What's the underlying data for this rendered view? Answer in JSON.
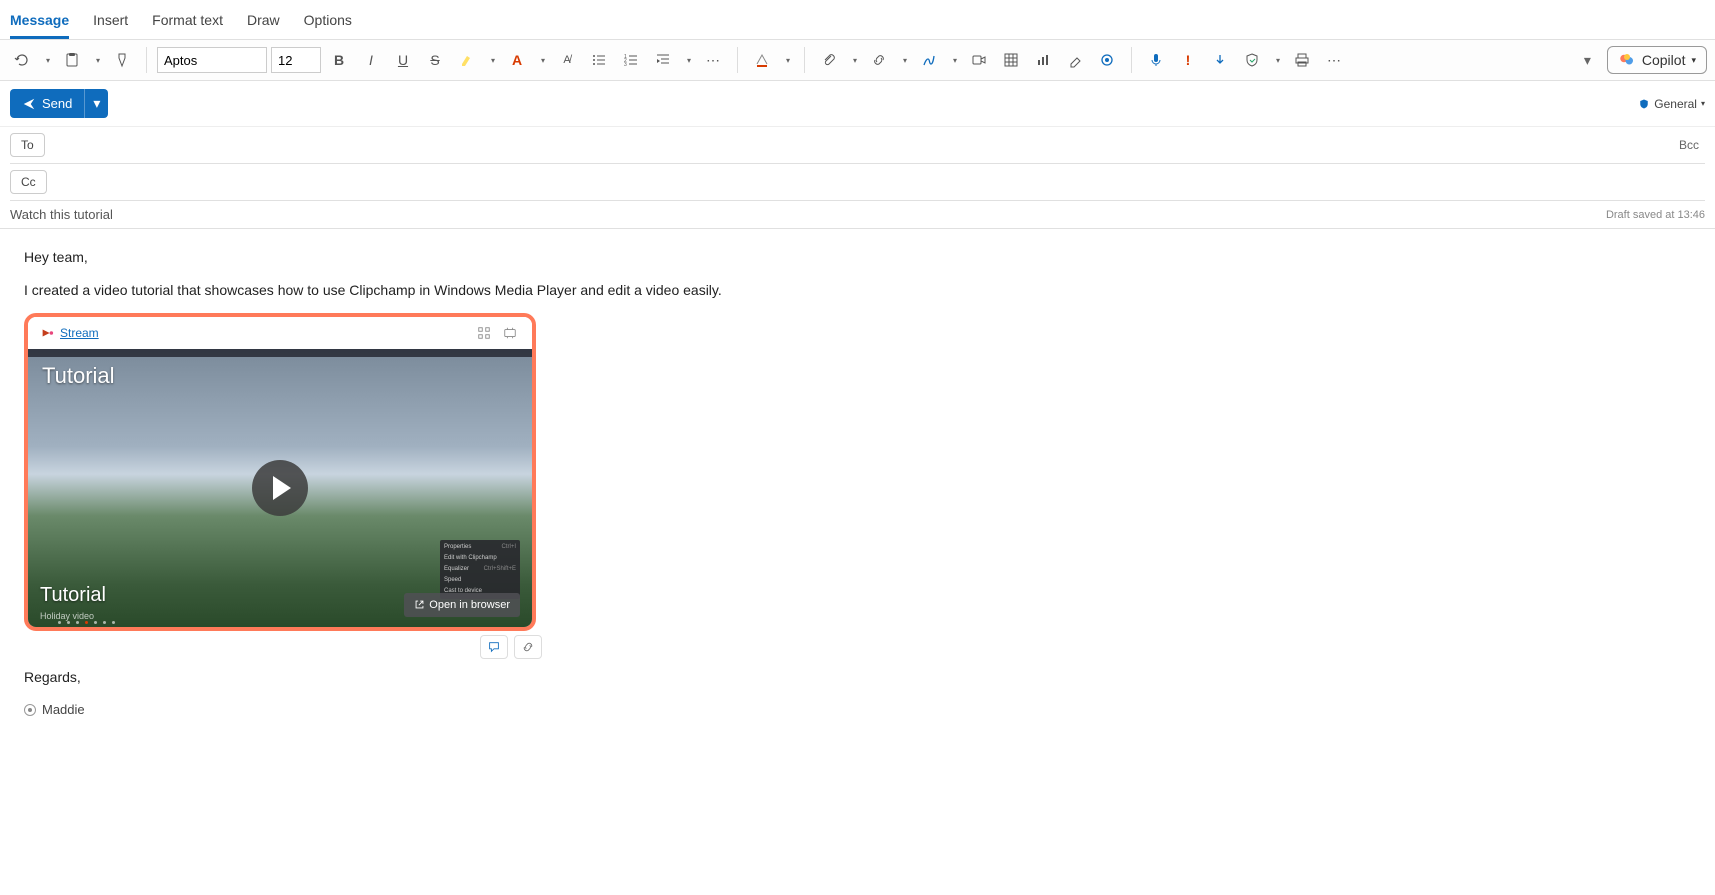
{
  "tabs": {
    "items": [
      "Message",
      "Insert",
      "Format text",
      "Draw",
      "Options"
    ],
    "active": 0
  },
  "ribbon": {
    "font_name": "Aptos",
    "font_size": "12"
  },
  "copilot": {
    "label": "Copilot"
  },
  "send": {
    "label": "Send"
  },
  "sensitivity": {
    "label": "General"
  },
  "recipients": {
    "to_label": "To",
    "cc_label": "Cc",
    "bcc_label": "Bcc",
    "to_value": "",
    "cc_value": ""
  },
  "subject": {
    "value": "Watch this tutorial",
    "draft_status": "Draft saved at 13:46"
  },
  "body": {
    "greeting": "Hey team,",
    "para1": "I created a video tutorial that showcases how to use Clipchamp in Windows Media Player and edit a video easily.",
    "regards": "Regards,",
    "signature": "Maddie"
  },
  "video_card": {
    "source_label": "Stream",
    "title_top": "Tutorial",
    "title_bottom": "Tutorial",
    "subtitle": "Holiday video",
    "open_label": "Open in browser",
    "context_menu": [
      {
        "label": "Properties",
        "hotkey": "Ctrl+I"
      },
      {
        "label": "Edit with Clipchamp",
        "hotkey": ""
      },
      {
        "label": "Equalizer",
        "hotkey": "Ctrl+Shift+E"
      },
      {
        "label": "Speed",
        "hotkey": ""
      },
      {
        "label": "Cast to device",
        "hotkey": ""
      }
    ]
  }
}
